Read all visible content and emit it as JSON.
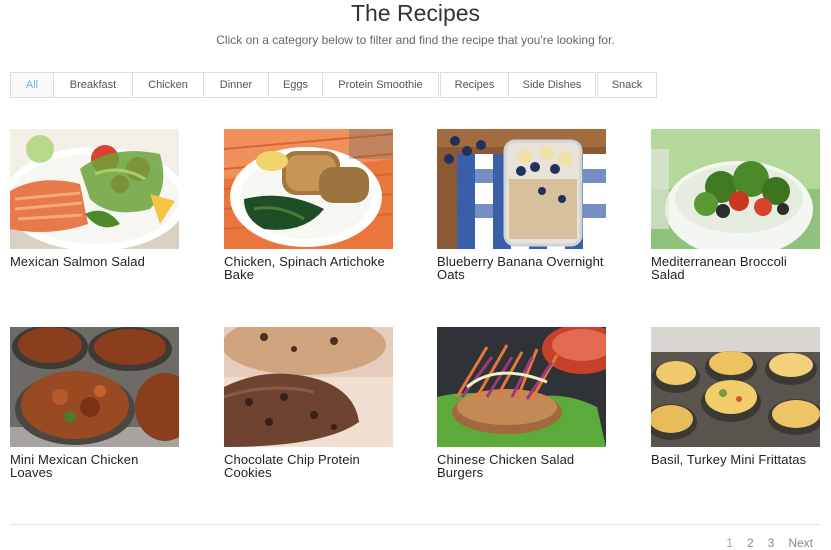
{
  "header": {
    "title": "The Recipes",
    "subtitle": "Click on a category below to filter and find the recipe that you're looking for."
  },
  "filters": [
    "All",
    "Breakfast",
    "Chicken",
    "Dinner",
    "Eggs",
    "Protein Smoothie",
    "Recipes",
    "Side Dishes",
    "Snack"
  ],
  "active_filter": "All",
  "recipes": [
    {
      "title": "Mexican Salmon Salad"
    },
    {
      "title": "Chicken, Spinach Artichoke Bake"
    },
    {
      "title": "Blueberry Banana Overnight Oats"
    },
    {
      "title": "Mediterranean Broccoli Salad"
    },
    {
      "title": "Mini Mexican Chicken Loaves"
    },
    {
      "title": "Chocolate Chip Protein Cookies"
    },
    {
      "title": "Chinese Chicken Salad Burgers"
    },
    {
      "title": "Basil, Turkey Mini Frittatas"
    }
  ],
  "pagination": {
    "pages": [
      "1",
      "2",
      "3"
    ],
    "next": "Next",
    "current": "1"
  }
}
